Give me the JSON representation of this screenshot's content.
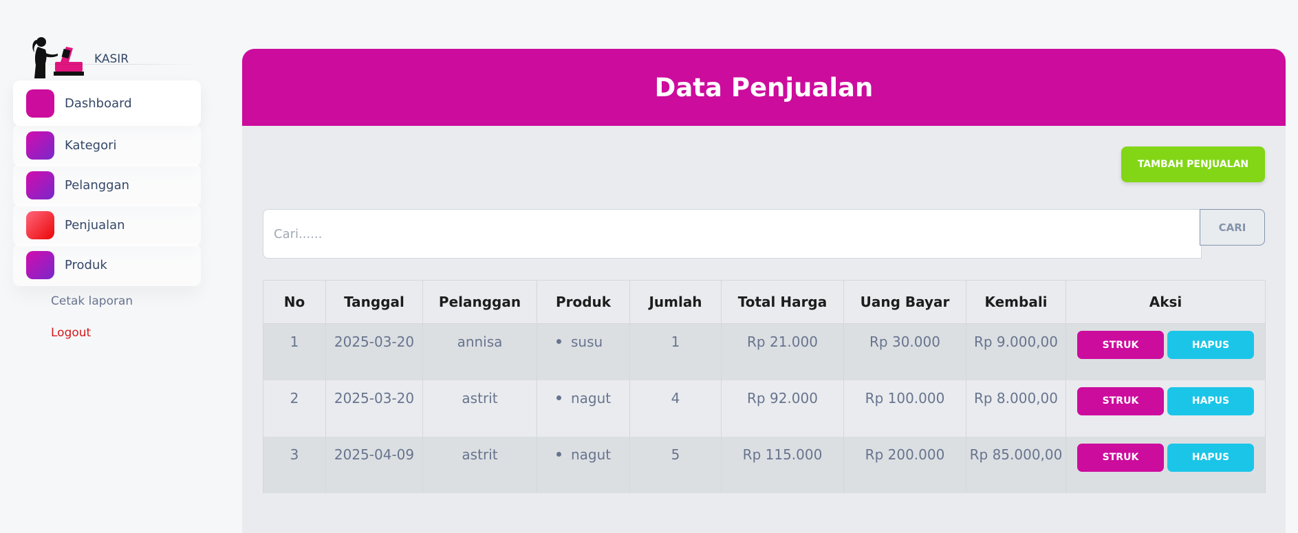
{
  "brand": {
    "name": "KASIR"
  },
  "sidebar": {
    "items": [
      {
        "label": "Dashboard",
        "icon": "dashboard-icon",
        "color": "#cc0c9d"
      },
      {
        "label": "Kategori",
        "icon": "kategori-icon",
        "color": "#a31fc4"
      },
      {
        "label": "Pelanggan",
        "icon": "pelanggan-icon",
        "color": "#a31fc4"
      },
      {
        "label": "Penjualan",
        "icon": "penjualan-icon",
        "color": "#ea0606"
      },
      {
        "label": "Produk",
        "icon": "produk-icon",
        "color": "#a31fc4"
      }
    ],
    "links": [
      {
        "label": "Cetak laporan",
        "color": "#67748e"
      },
      {
        "label": "Logout",
        "color": "#d1191b"
      }
    ]
  },
  "main": {
    "title": "Data Penjualan",
    "add_button": "TAMBAH PENJUALAN",
    "search": {
      "placeholder": "Cari......",
      "value": "",
      "button": "CARI"
    },
    "table": {
      "headers": [
        "No",
        "Tanggal",
        "Pelanggan",
        "Produk",
        "Jumlah",
        "Total Harga",
        "Uang Bayar",
        "Kembali",
        "Aksi"
      ],
      "rows": [
        {
          "no": "1",
          "tanggal": "2025-03-20",
          "pelanggan": "annisa",
          "produk": "susu",
          "jumlah": "1",
          "total": "Rp 21.000",
          "bayar": "Rp 30.000",
          "kembali": "Rp 9.000,00",
          "struk": "STRUK",
          "hapus": "HAPUS"
        },
        {
          "no": "2",
          "tanggal": "2025-03-20",
          "pelanggan": "astrit",
          "produk": "nagut",
          "jumlah": "4",
          "total": "Rp 92.000",
          "bayar": "Rp 100.000",
          "kembali": "Rp 8.000,00",
          "struk": "STRUK",
          "hapus": "HAPUS"
        },
        {
          "no": "3",
          "tanggal": "2025-04-09",
          "pelanggan": "astrit",
          "produk": "nagut",
          "jumlah": "5",
          "total": "Rp 115.000",
          "bayar": "Rp 200.000",
          "kembali": "Rp 85.000,00",
          "struk": "STRUK",
          "hapus": "HAPUS"
        }
      ]
    }
  },
  "colors": {
    "accent": "#cc0c9d",
    "success": "#82d616",
    "info": "#1bc5e8",
    "danger": "#d1191b"
  }
}
